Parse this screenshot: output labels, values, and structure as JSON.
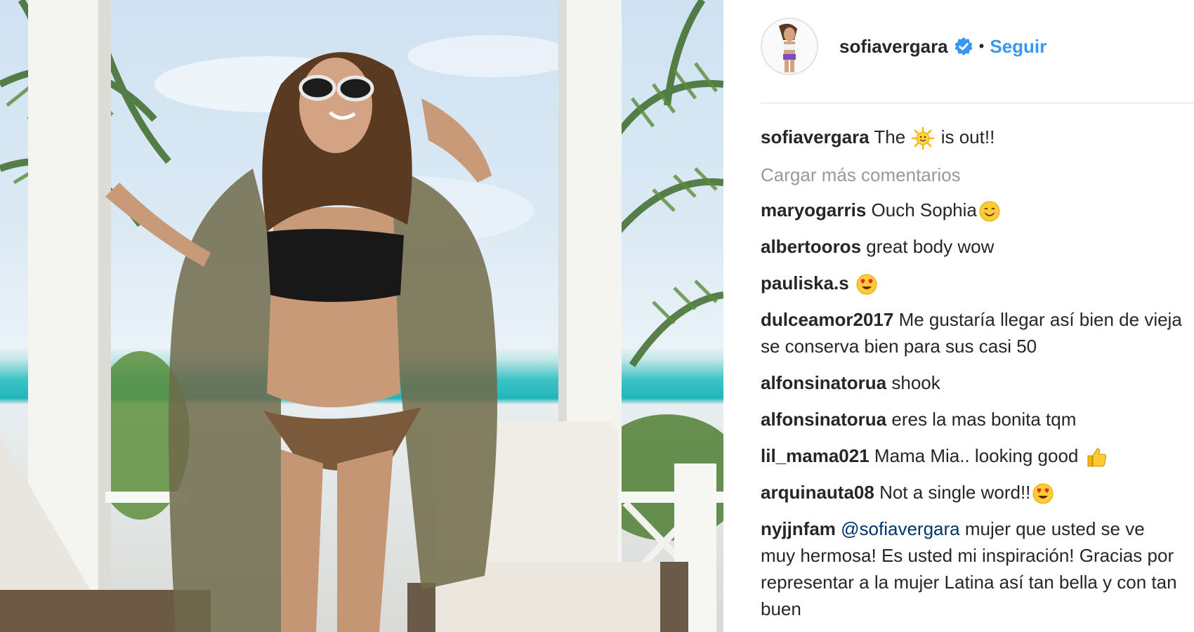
{
  "post": {
    "author": "sofiavergara",
    "follow_label": "Seguir",
    "separator": "•",
    "caption_user": "sofiavergara",
    "caption_before": "The",
    "caption_emoji": "sun-icon",
    "caption_after": "is out!!"
  },
  "load_more_label": "Cargar más comentarios",
  "comments": [
    {
      "user": "maryogarris",
      "text": "Ouch Sophia",
      "emoji": "smiling-face-icon"
    },
    {
      "user": "albertooros",
      "text": "great body wow",
      "emoji": ""
    },
    {
      "user": "pauliska.s",
      "text": "",
      "emoji": "heart-eyes-icon"
    },
    {
      "user": "dulceamor2017",
      "text": "Me gustaría llegar así bien de vieja se conserva bien para sus casi 50",
      "emoji": ""
    },
    {
      "user": "alfonsinatorua",
      "text": "shook",
      "emoji": ""
    },
    {
      "user": "alfonsinatorua",
      "text": "eres la mas bonita tqm",
      "emoji": ""
    },
    {
      "user": "lil_mama021",
      "text": "Mama Mia.. looking good",
      "emoji": "thumbs-up-icon"
    },
    {
      "user": "arquinauta08",
      "text": "Not a single word!!",
      "emoji": "heart-eyes-icon"
    },
    {
      "user": "nyjjnfam",
      "mention": "@sofiavergara",
      "text": "mujer que usted se ve muy hermosa! Es usted mi inspiración! Gracias por representar a la mujer Latina así tan bella y con tan buen",
      "emoji": ""
    }
  ],
  "colors": {
    "link_blue": "#3897f0",
    "muted": "#999999",
    "mention": "#003569",
    "verified": "#3897f0"
  }
}
